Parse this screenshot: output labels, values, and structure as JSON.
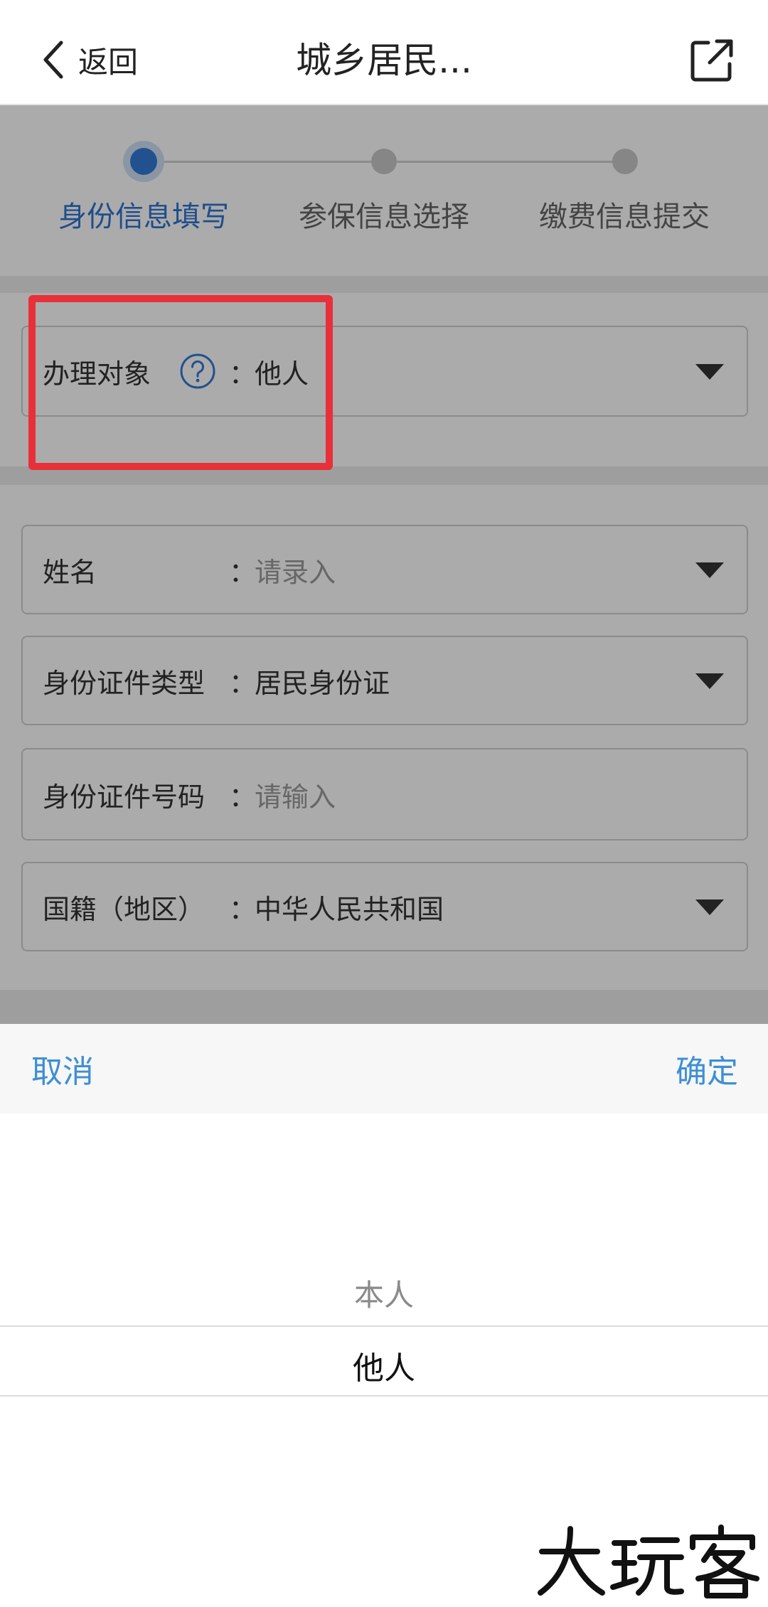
{
  "navbar": {
    "back_label": "返回",
    "title": "城乡居民..."
  },
  "steps": [
    {
      "label": "身份信息填写",
      "active": true
    },
    {
      "label": "参保信息选择",
      "active": false
    },
    {
      "label": "缴费信息提交",
      "active": false
    }
  ],
  "fields": {
    "applicant": {
      "label": "办理对象",
      "colon": "：",
      "value": "他人"
    },
    "name": {
      "label": "姓名",
      "colon": "：",
      "placeholder": "请录入"
    },
    "id_type": {
      "label": "身份证件类型",
      "colon": "：",
      "value": "居民身份证"
    },
    "id_number": {
      "label": "身份证件号码",
      "colon": "：",
      "placeholder": "请输入"
    },
    "nationality": {
      "label": "国籍（地区）",
      "colon": "：",
      "value": "中华人民共和国"
    }
  },
  "picker": {
    "cancel_label": "取消",
    "confirm_label": "确定",
    "options": [
      "本人",
      "他人"
    ],
    "selected": "他人"
  },
  "colors": {
    "accent": "#2f74cf",
    "picker_action": "#3d8fd4",
    "highlight": "#e8303a"
  },
  "icons": {
    "back": "chevron-left-icon",
    "share": "external-link-icon",
    "help": "question-circle-icon",
    "caret": "caret-down-icon"
  }
}
